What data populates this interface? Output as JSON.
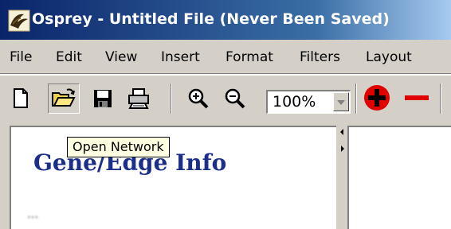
{
  "window": {
    "title": "Osprey - Untitled File (Never Been Saved)",
    "app_icon": "osprey-bird-icon"
  },
  "menubar": {
    "items": [
      "File",
      "Edit",
      "View",
      "Insert",
      "Format",
      "Filters",
      "Layout"
    ]
  },
  "toolbar": {
    "buttons": [
      "new-file-icon",
      "open-folder-icon",
      "save-disk-icon",
      "print-icon",
      "zoom-in-icon",
      "zoom-out-icon",
      "add-node-icon",
      "remove-node-icon"
    ],
    "zoom_value": "100%",
    "add_color": "#e00000",
    "remove_color": "#e00000"
  },
  "tooltip": {
    "text": "Open Network"
  },
  "left_panel": {
    "heading": "Gene/Edge Info",
    "faint_text": "...",
    "heading_color": "#1b2f8a"
  },
  "colors": {
    "titlebar_start": "#0a246a",
    "titlebar_end": "#a6caf0",
    "chrome": "#d4d0c8"
  }
}
